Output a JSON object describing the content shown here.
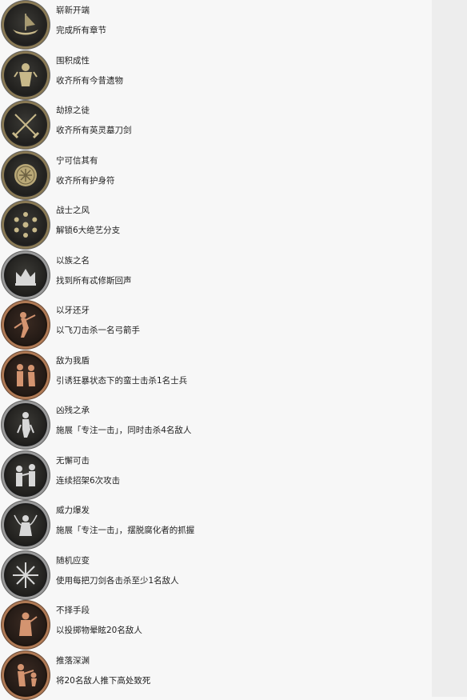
{
  "achievements": [
    {
      "title": "崭新开端",
      "desc": "完成所有章节",
      "icon": "boat-icon"
    },
    {
      "title": "围积成性",
      "desc": "收齐所有今昔遗物",
      "icon": "idol-icon"
    },
    {
      "title": "劫掠之徒",
      "desc": "收齐所有英灵墓刀剑",
      "icon": "crossed-swords-icon"
    },
    {
      "title": "宁可信其有",
      "desc": "收齐所有护身符",
      "icon": "amulet-icon"
    },
    {
      "title": "战士之风",
      "desc": "解锁6大绝艺分支",
      "icon": "skill-wheel-icon"
    },
    {
      "title": "以族之名",
      "desc": "找到所有忒修斯回声",
      "icon": "crown-icon"
    },
    {
      "title": "以牙还牙",
      "desc": "以飞刀击杀一名弓箭手",
      "icon": "knife-throw-icon"
    },
    {
      "title": "敌为我盾",
      "desc": "引诱狂暴状态下的蛮士击杀1名士兵",
      "icon": "berserker-icon"
    },
    {
      "title": "凶残之承",
      "desc": "施展「专注一击」，同时击杀4名敌人",
      "icon": "focus-strike-icon"
    },
    {
      "title": "无懈可击",
      "desc": "连续招架6次攻击",
      "icon": "parry-icon"
    },
    {
      "title": "威力爆发",
      "desc": "施展「专注一击」，摆脱腐化者的抓握",
      "icon": "grab-escape-icon"
    },
    {
      "title": "随机应变",
      "desc": "使用每把刀剑各击杀至少1名敌人",
      "icon": "swords-star-icon"
    },
    {
      "title": "不择手段",
      "desc": "以投掷物晕眩20名敌人",
      "icon": "throw-stun-icon"
    },
    {
      "title": "推落深渊",
      "desc": "将20名敌人推下高处致死",
      "icon": "push-off-icon"
    }
  ]
}
